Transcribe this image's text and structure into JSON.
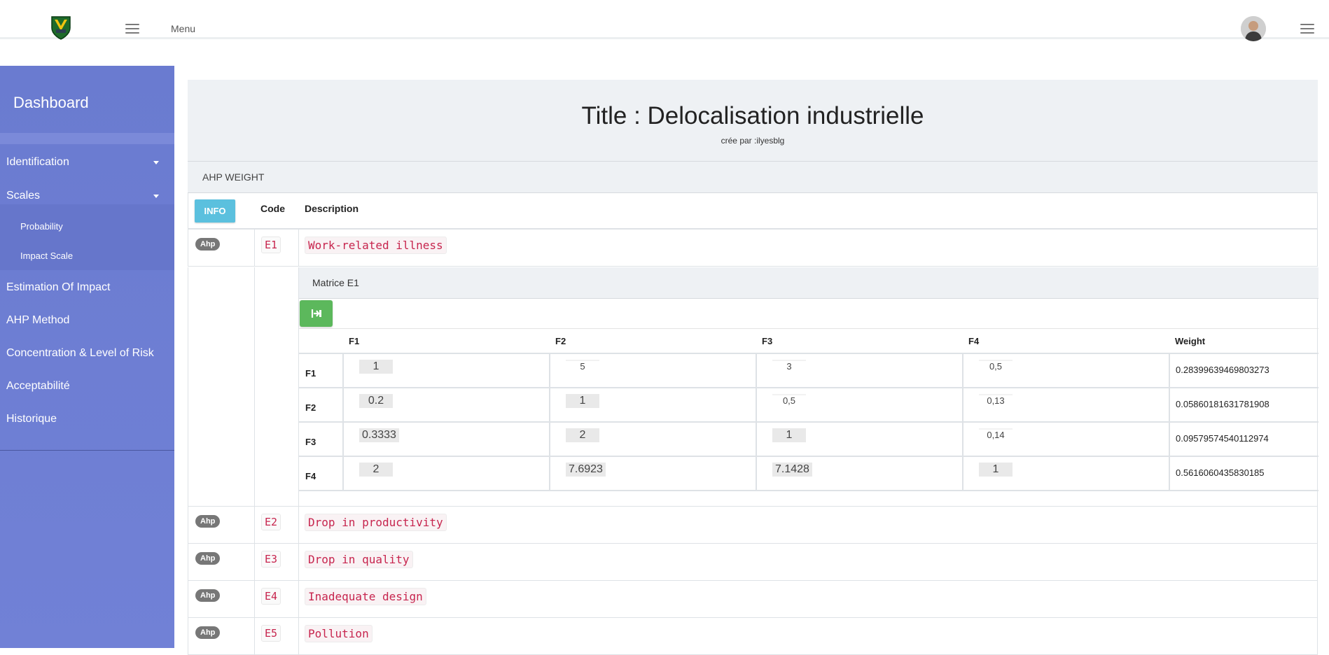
{
  "topbar": {
    "menu_label": "Menu"
  },
  "sidebar": {
    "title": "Dashboard",
    "items": [
      {
        "label": "Identification"
      },
      {
        "label": "Scales"
      },
      {
        "label": "Probability"
      },
      {
        "label": "Impact Scale"
      },
      {
        "label": "Estimation Of Impact"
      },
      {
        "label": "AHP Method"
      },
      {
        "label": "Concentration & Level of Risk"
      },
      {
        "label": "Acceptabilité"
      },
      {
        "label": "Historique"
      }
    ]
  },
  "page": {
    "title": "Title : Delocalisation industrielle",
    "subtitle": "crée par :ilyesblg",
    "section": "AHP WEIGHT"
  },
  "table": {
    "info_button": "INFO",
    "headers": {
      "code": "Code",
      "description": "Description"
    },
    "rows": [
      {
        "badge": "Ahp",
        "code": "E1",
        "description": "Work-related illness"
      },
      {
        "badge": "Ahp",
        "code": "E2",
        "description": "Drop in productivity"
      },
      {
        "badge": "Ahp",
        "code": "E3",
        "description": "Drop in quality"
      },
      {
        "badge": "Ahp",
        "code": "E4",
        "description": "Inadequate design"
      },
      {
        "badge": "Ahp",
        "code": "E5",
        "description": "Pollution"
      }
    ]
  },
  "matrix": {
    "label": "Matrice E1",
    "headers": [
      "F1",
      "F2",
      "F3",
      "F4",
      "Weight"
    ],
    "rows": [
      {
        "label": "F1",
        "values": [
          "1",
          "5",
          "3",
          "0,5"
        ],
        "weight": "0.28399639469803273"
      },
      {
        "label": "F2",
        "values": [
          "0.2",
          "1",
          "0,5",
          "0,13"
        ],
        "weight": "0.05860181631781908"
      },
      {
        "label": "F3",
        "values": [
          "0.3333",
          "2",
          "1",
          "0,14"
        ],
        "weight": "0.09579574540112974"
      },
      {
        "label": "F4",
        "values": [
          "2",
          "7.6923",
          "7.1428",
          "1"
        ],
        "weight": "0.5616060435830185"
      }
    ]
  },
  "colors": {
    "sidebar": "#6a7bd0",
    "info": "#5bc0de",
    "save": "#5cb85c",
    "code_text": "#c7254e"
  }
}
